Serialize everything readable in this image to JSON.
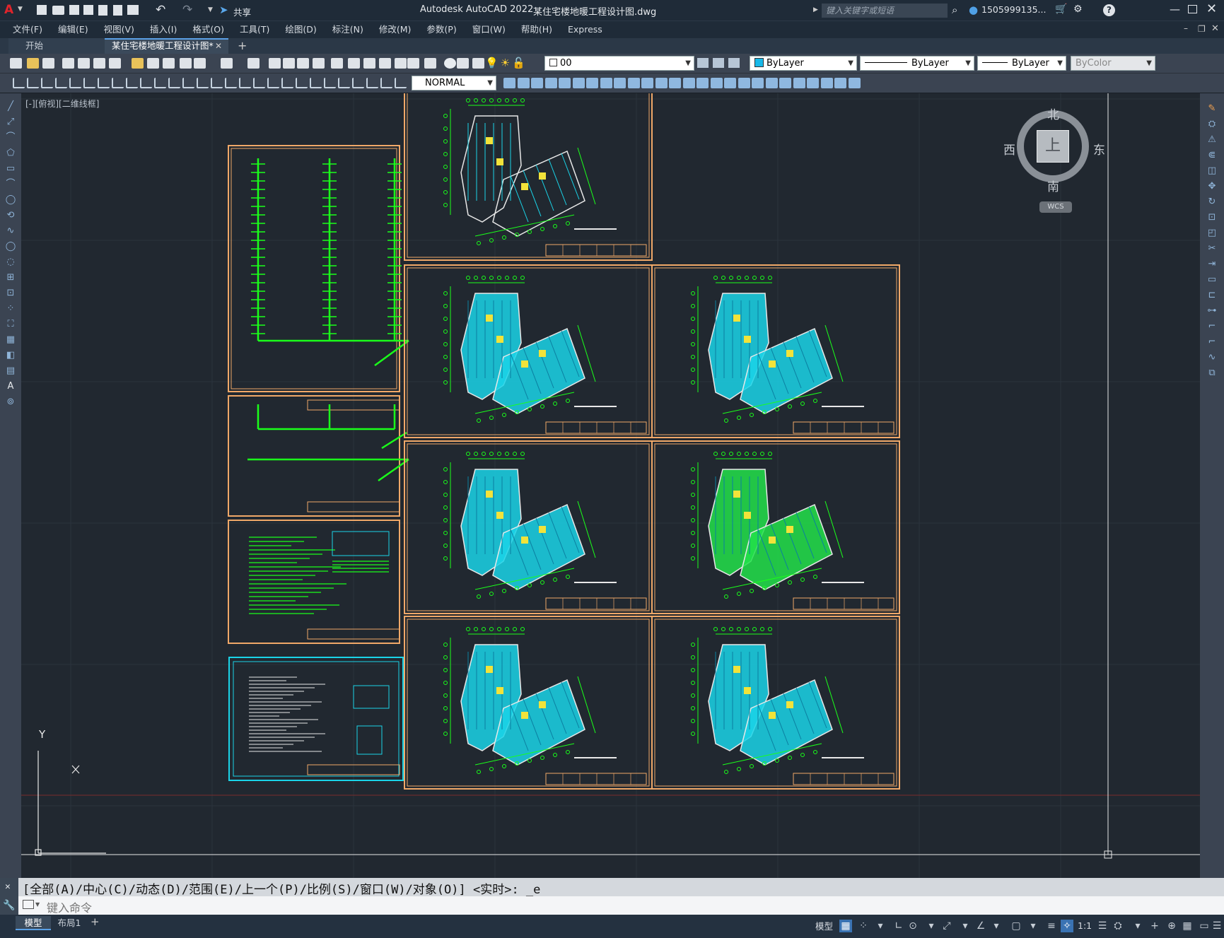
{
  "titlebar": {
    "app_title": "Autodesk AutoCAD 2022",
    "file_title": "某住宅楼地暖工程设计图.dwg",
    "share_label": "共享",
    "search_placeholder": "键入关键字或短语",
    "user_label": "1505999135..."
  },
  "menu": [
    "文件(F)",
    "编辑(E)",
    "视图(V)",
    "插入(I)",
    "格式(O)",
    "工具(T)",
    "绘图(D)",
    "标注(N)",
    "修改(M)",
    "参数(P)",
    "窗口(W)",
    "帮助(H)",
    "Express"
  ],
  "tabs": {
    "start": "开始",
    "active": "某住宅楼地暖工程设计图*",
    "new": "+"
  },
  "properties": {
    "layer": "00",
    "color": "ByLayer",
    "linetype": "ByLayer",
    "lineweight": "ByLayer",
    "plotstyle": "ByColor",
    "dimstyle": "NORMAL"
  },
  "viewport": {
    "label": "[-][俯视][二维线框]",
    "viewcube": {
      "north": "北",
      "south": "南",
      "east": "东",
      "west": "西",
      "top": "上",
      "ucs": "WCS"
    },
    "ucs_y": "Y",
    "ucs_x": "X"
  },
  "command": {
    "history": "[全部(A)/中心(C)/动态(D)/范围(E)/上一个(P)/比例(S)/窗口(W)/对象(O)] <实时>: _e",
    "placeholder": "键入命令"
  },
  "layout_tabs": {
    "model": "模型",
    "layout1": "布局1",
    "add": "+"
  },
  "status": {
    "model": "模型",
    "scale": "1:1"
  },
  "colors": {
    "frame": "#f0a868",
    "pipe": "#1aff1a",
    "floor_fill": "#1ad4e8",
    "wall": "#f0f0f0",
    "accent": "#1f88d6"
  }
}
